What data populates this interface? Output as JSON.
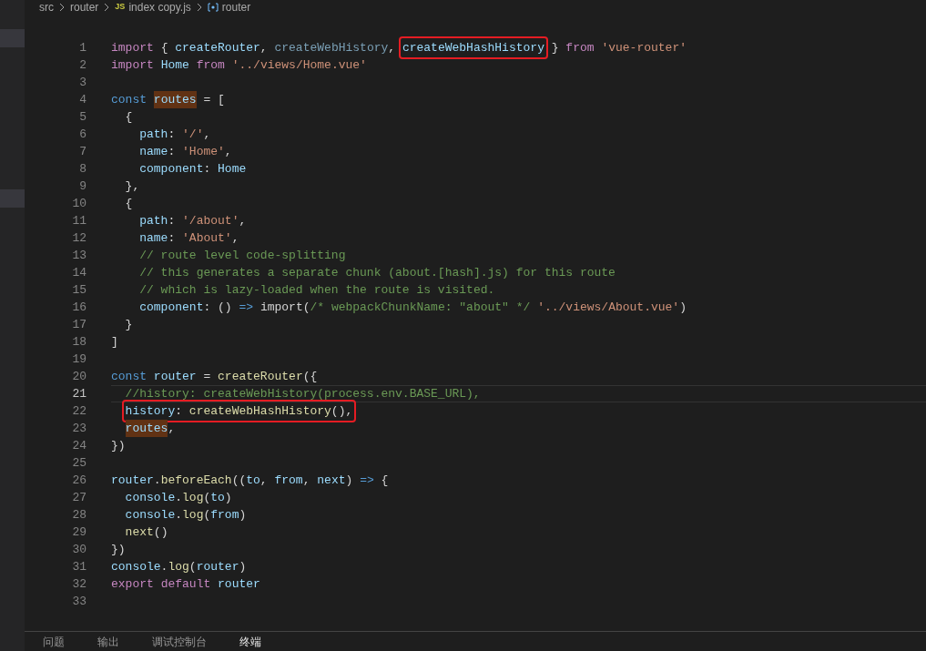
{
  "breadcrumb": [
    {
      "kind": "folder",
      "label": "src"
    },
    {
      "kind": "folder",
      "label": "router"
    },
    {
      "kind": "js-file",
      "label": "index copy.js",
      "icon": "JS"
    },
    {
      "kind": "symbol",
      "label": "router"
    }
  ],
  "editor": {
    "lines": [
      {
        "n": "1",
        "tokens": [
          {
            "kind": "kw",
            "text": "import"
          },
          {
            "kind": "p",
            "text": " { "
          },
          {
            "kind": "var",
            "text": "createRouter"
          },
          {
            "kind": "p",
            "text": ", "
          },
          {
            "kind": "dim",
            "text": "createWebHistory"
          },
          {
            "kind": "p",
            "text": ", "
          },
          {
            "kind": "var",
            "text": "createWebHashHistory",
            "boxed": true
          },
          {
            "kind": "p",
            "text": " } "
          },
          {
            "kind": "kw",
            "text": "from"
          },
          {
            "kind": "str",
            "text": " 'vue-router'"
          }
        ]
      },
      {
        "n": "2",
        "tokens": [
          {
            "kind": "kw",
            "text": "import"
          },
          {
            "kind": "var",
            "text": " Home"
          },
          {
            "kind": "kw",
            "text": " from"
          },
          {
            "kind": "str",
            "text": " '../views/Home.vue'"
          }
        ]
      },
      {
        "n": "3"
      },
      {
        "n": "4",
        "tokens": [
          {
            "kind": "st",
            "text": "const"
          },
          {
            "kind": "var",
            "text": " routes",
            "highlighted": true
          },
          {
            "kind": "p",
            "text": " = ["
          }
        ]
      },
      {
        "n": "5",
        "tokens": [
          {
            "kind": "p",
            "text": "  {"
          }
        ]
      },
      {
        "n": "6",
        "tokens": [
          {
            "kind": "var",
            "text": "    path"
          },
          {
            "kind": "p",
            "text": ": "
          },
          {
            "kind": "str",
            "text": "'/'"
          },
          {
            "kind": "p",
            "text": ","
          }
        ]
      },
      {
        "n": "7",
        "tokens": [
          {
            "kind": "var",
            "text": "    name"
          },
          {
            "kind": "p",
            "text": ": "
          },
          {
            "kind": "str",
            "text": "'Home'"
          },
          {
            "kind": "p",
            "text": ","
          }
        ]
      },
      {
        "n": "8",
        "tokens": [
          {
            "kind": "var",
            "text": "    component"
          },
          {
            "kind": "p",
            "text": ": "
          },
          {
            "kind": "var",
            "text": "Home"
          }
        ]
      },
      {
        "n": "9",
        "tokens": [
          {
            "kind": "p",
            "text": "  },"
          }
        ]
      },
      {
        "n": "10",
        "tokens": [
          {
            "kind": "p",
            "text": "  {"
          }
        ]
      },
      {
        "n": "11",
        "tokens": [
          {
            "kind": "var",
            "text": "    path"
          },
          {
            "kind": "p",
            "text": ": "
          },
          {
            "kind": "str",
            "text": "'/about'"
          },
          {
            "kind": "p",
            "text": ","
          }
        ]
      },
      {
        "n": "12",
        "tokens": [
          {
            "kind": "var",
            "text": "    name"
          },
          {
            "kind": "p",
            "text": ": "
          },
          {
            "kind": "str",
            "text": "'About'"
          },
          {
            "kind": "p",
            "text": ","
          }
        ]
      },
      {
        "n": "13",
        "tokens": [
          {
            "kind": "cm",
            "text": "    // route level code-splitting"
          }
        ]
      },
      {
        "n": "14",
        "tokens": [
          {
            "kind": "cm",
            "text": "    // this generates a separate chunk (about.[hash].js) for this route"
          }
        ]
      },
      {
        "n": "15",
        "tokens": [
          {
            "kind": "cm",
            "text": "    // which is lazy-loaded when the route is visited."
          }
        ]
      },
      {
        "n": "16",
        "tokens": [
          {
            "kind": "var",
            "text": "    component"
          },
          {
            "kind": "p",
            "text": ": () "
          },
          {
            "kind": "st",
            "text": "=>"
          },
          {
            "kind": "p",
            "text": " import("
          },
          {
            "kind": "cm",
            "text": "/* webpackChunkName: \"about\" */"
          },
          {
            "kind": "str",
            "text": " '../views/About.vue'"
          },
          {
            "kind": "p",
            "text": ")"
          }
        ]
      },
      {
        "n": "17",
        "tokens": [
          {
            "kind": "p",
            "text": "  }"
          }
        ]
      },
      {
        "n": "18",
        "tokens": [
          {
            "kind": "p",
            "text": "]"
          }
        ]
      },
      {
        "n": "19"
      },
      {
        "n": "20",
        "tokens": [
          {
            "kind": "st",
            "text": "const"
          },
          {
            "kind": "var",
            "text": " router"
          },
          {
            "kind": "p",
            "text": " = "
          },
          {
            "kind": "fn",
            "text": "createRouter"
          },
          {
            "kind": "p",
            "text": "({"
          }
        ]
      },
      {
        "n": "21",
        "current": true,
        "tokens": [
          {
            "kind": "cm",
            "text": "  //history: createWebHistory(process.env.BASE_URL),"
          }
        ]
      },
      {
        "n": "22",
        "tokens": [
          {
            "kind": "var",
            "text": "  history",
            "boxed": true
          },
          {
            "kind": "p",
            "text": ": ",
            "boxed": true
          },
          {
            "kind": "fn",
            "text": "createWebHashHistory",
            "boxed": true
          },
          {
            "kind": "p",
            "text": "(),",
            "boxed": true
          }
        ]
      },
      {
        "n": "23",
        "tokens": [
          {
            "kind": "var",
            "text": "  routes",
            "highlighted": true
          },
          {
            "kind": "p",
            "text": ","
          }
        ]
      },
      {
        "n": "24",
        "tokens": [
          {
            "kind": "p",
            "text": "})"
          }
        ]
      },
      {
        "n": "25"
      },
      {
        "n": "26",
        "tokens": [
          {
            "kind": "var",
            "text": "router"
          },
          {
            "kind": "p",
            "text": "."
          },
          {
            "kind": "fn",
            "text": "beforeEach"
          },
          {
            "kind": "p",
            "text": "(("
          },
          {
            "kind": "var",
            "text": "to"
          },
          {
            "kind": "p",
            "text": ", "
          },
          {
            "kind": "var",
            "text": "from"
          },
          {
            "kind": "p",
            "text": ", "
          },
          {
            "kind": "var",
            "text": "next"
          },
          {
            "kind": "p",
            "text": ") "
          },
          {
            "kind": "st",
            "text": "=>"
          },
          {
            "kind": "p",
            "text": " {"
          }
        ]
      },
      {
        "n": "27",
        "tokens": [
          {
            "kind": "var",
            "text": "  console"
          },
          {
            "kind": "p",
            "text": "."
          },
          {
            "kind": "fn",
            "text": "log"
          },
          {
            "kind": "p",
            "text": "("
          },
          {
            "kind": "var",
            "text": "to"
          },
          {
            "kind": "p",
            "text": ")"
          }
        ]
      },
      {
        "n": "28",
        "tokens": [
          {
            "kind": "var",
            "text": "  console"
          },
          {
            "kind": "p",
            "text": "."
          },
          {
            "kind": "fn",
            "text": "log"
          },
          {
            "kind": "p",
            "text": "("
          },
          {
            "kind": "var",
            "text": "from"
          },
          {
            "kind": "p",
            "text": ")"
          }
        ]
      },
      {
        "n": "29",
        "tokens": [
          {
            "kind": "fn",
            "text": "  next"
          },
          {
            "kind": "p",
            "text": "()"
          }
        ]
      },
      {
        "n": "30",
        "tokens": [
          {
            "kind": "p",
            "text": "})"
          }
        ]
      },
      {
        "n": "31",
        "tokens": [
          {
            "kind": "var",
            "text": "console"
          },
          {
            "kind": "p",
            "text": "."
          },
          {
            "kind": "fn",
            "text": "log"
          },
          {
            "kind": "p",
            "text": "("
          },
          {
            "kind": "var",
            "text": "router"
          },
          {
            "kind": "p",
            "text": ")"
          }
        ]
      },
      {
        "n": "32",
        "tokens": [
          {
            "kind": "kw",
            "text": "export"
          },
          {
            "kind": "kw",
            "text": " default"
          },
          {
            "kind": "var",
            "text": " router"
          }
        ]
      },
      {
        "n": "33"
      }
    ]
  },
  "panel": {
    "tabs": [
      {
        "label": "问题",
        "selected": false
      },
      {
        "label": "输出",
        "selected": false
      },
      {
        "label": "调试控制台",
        "selected": false
      },
      {
        "label": "终端",
        "selected": true
      }
    ]
  }
}
